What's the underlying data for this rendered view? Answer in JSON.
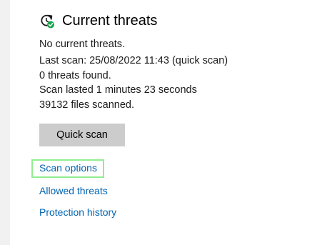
{
  "header": {
    "title": "Current threats",
    "icon": "refresh-shield-check-icon"
  },
  "status": {
    "summary": "No current threats.",
    "last_scan": "Last scan: 25/08/2022 11:43 (quick scan)",
    "threats_found": "0 threats found.",
    "duration": "Scan lasted 1 minutes 23 seconds",
    "files_scanned": "39132 files scanned."
  },
  "actions": {
    "quick_scan_label": "Quick scan"
  },
  "links": {
    "scan_options": "Scan options",
    "allowed_threats": "Allowed threats",
    "protection_history": "Protection history"
  },
  "colors": {
    "link": "#0063b1",
    "button_bg": "#cccccc",
    "focus_ring": "#90ee90",
    "check_badge": "#16a34a"
  }
}
